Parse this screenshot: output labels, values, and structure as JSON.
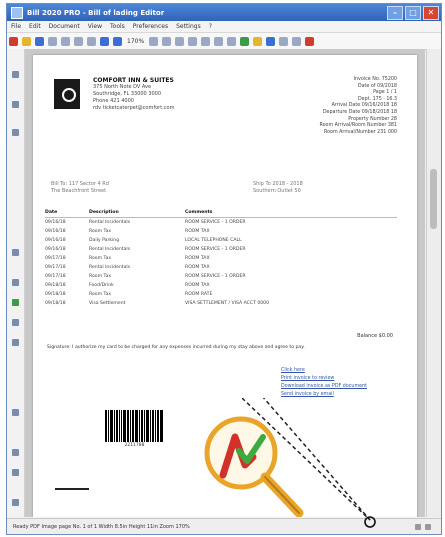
{
  "window": {
    "title": "Bill 2020 PRO - Bill of lading Editor",
    "controls": {
      "minimize": "–",
      "maximize": "□",
      "close": "✕"
    }
  },
  "menu": [
    "File",
    "Edit",
    "Document",
    "View",
    "Tools",
    "Preferences",
    "Settings",
    "?"
  ],
  "toolbar": {
    "zoom": "170%"
  },
  "invoice": {
    "company": {
      "name": "COMFORT INN & SUITES",
      "lines": [
        "375 North Note DV Ave",
        "Southridge, FL 33000 3000",
        "Phone 421 4000",
        "rdv ticketcaterpet@comfort.com"
      ]
    },
    "meta": [
      "Invoice No. 75200",
      "Date of 09/2018",
      "Page 1 / 1",
      "Dept. 175 · 16.3",
      "Arrival Date 09/16/2018 18",
      "Departure Date 09/18/2018 18",
      "Property Number 28",
      "Room Arrival/Room Number 381",
      "Room Arrival/Number 231 000"
    ],
    "bill_to": [
      "Bill To: 117 Sector 4 Rd",
      "The Beachfront Street"
    ],
    "ship_to": [
      "Ship To 2018 - 2018",
      "Southern Outlet 50"
    ],
    "table": {
      "headers": [
        "Date",
        "Description",
        "Comments"
      ],
      "rows": [
        [
          "09/16/18",
          "Rental Incidentals",
          "ROOM SERVICE - 1 ORDER"
        ],
        [
          "09/16/18",
          "Room Tax",
          "ROOM TAX"
        ],
        [
          "09/16/18",
          "Daily Parking",
          "LOCAL TELEPHONE CALL"
        ],
        [
          "09/16/18",
          "Rental Incidentals",
          "ROOM SERVICE - 1 ORDER"
        ],
        [
          "09/17/18",
          "Room Tax",
          "ROOM TAX"
        ],
        [
          "09/17/18",
          "Rental Incidentals",
          "ROOM TAX"
        ],
        [
          "09/17/18",
          "Room Tax",
          "ROOM SERVICE - 1 ORDER"
        ],
        [
          "09/18/18",
          "Food/Drink",
          "ROOM TAX"
        ],
        [
          "09/18/18",
          "Room Tax",
          "ROOM RATE"
        ],
        [
          "09/18/18",
          "Visa Settlement",
          "VISA SETTLEMENT / VISA ACCT 0000"
        ]
      ]
    },
    "total": "Balance $0.00",
    "note": "Signature: I authorize my card to be charged for any expenses incurred during my stay above and agree to pay.",
    "links": [
      "Click here",
      "Print invoice to review",
      "Download invoice as PDF document",
      "Send invoice by email"
    ],
    "barcode_number": "2211788"
  },
  "statusbar": {
    "text": "Ready  PDF Image page No. 1 of 1  Width 8.5in  Height 11in  Zoom 170%",
    "zoom_label": "170%"
  },
  "colors": {
    "accent": "#2f63b8",
    "callout_red": "#d2312a",
    "callout_green": "#3caa3c",
    "magnifier": "#e8a52a"
  }
}
